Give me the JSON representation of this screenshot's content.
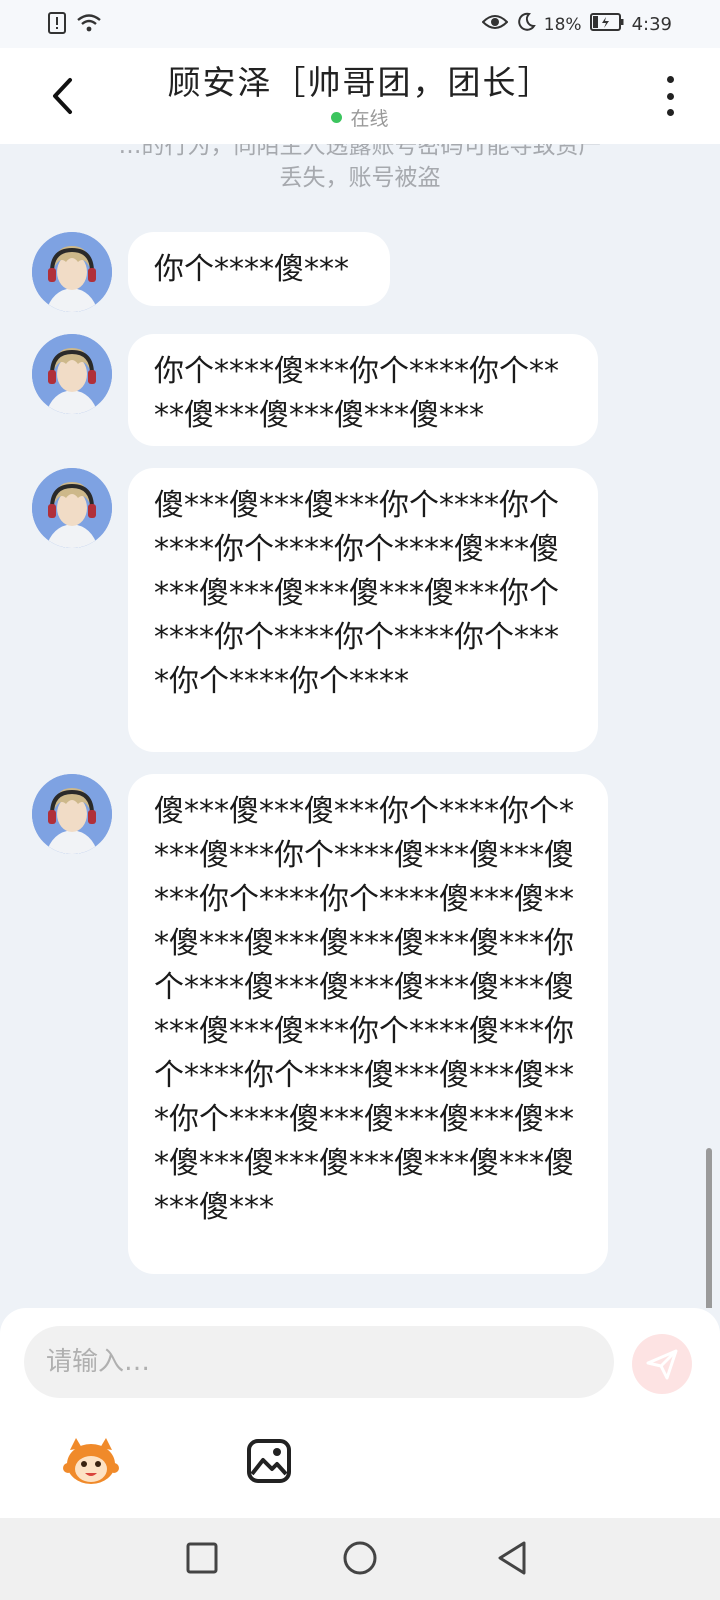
{
  "status_bar": {
    "battery": "18%",
    "time": "4:39",
    "icons": [
      "alert-icon",
      "wifi-icon",
      "eye-icon",
      "moon-icon",
      "battery-icon"
    ]
  },
  "header": {
    "title": "顾安泽［帅哥团，团长］",
    "status": "在线",
    "status_color": "#3cc55e",
    "back_icon": "chevron-left-icon",
    "more_icon": "more-vertical-icon"
  },
  "chat": {
    "notice_line1": "…的行为，同陌生人透露账号密码可能导致资产",
    "notice_line2": "丢失，账号被盗",
    "messages": [
      {
        "text": "你个****傻***"
      },
      {
        "text": "你个****傻***你个****你个****傻***傻***傻***傻***"
      },
      {
        "text": "傻***傻***傻***你个****你个****你个****你个****傻***傻***傻***傻***傻***傻***你个****你个****你个****你个****你个****你个****"
      },
      {
        "text": "傻***傻***傻***你个****你个****傻***你个****傻***傻***傻***你个****你个****傻***傻***傻***傻***傻***傻***傻***你个****傻***傻***傻***傻***傻***傻***傻***你个****傻***你个****你个****傻***傻***傻***你个****傻***傻***傻***傻***傻***傻***傻***傻***傻***傻***傻***"
      }
    ]
  },
  "input": {
    "placeholder": "请输入…",
    "send_icon": "send-icon",
    "emoji_icon": "emoji-sticker-icon",
    "image_icon": "image-icon",
    "accent": "#f36b6b"
  },
  "nav": {
    "icons": [
      "square-recents-icon",
      "circle-home-icon",
      "triangle-back-icon"
    ]
  }
}
